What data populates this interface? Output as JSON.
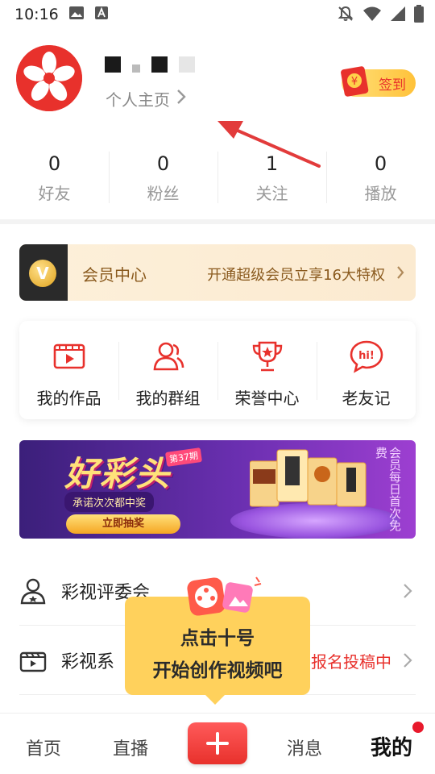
{
  "status_bar": {
    "time": "10:16",
    "icons": [
      "image-icon",
      "a-icon",
      "mute-icon",
      "wifi-icon",
      "signal-icon",
      "battery-icon"
    ]
  },
  "profile": {
    "homepage_label": "个人主页",
    "checkin_label": "签到",
    "checkin_envelope_glyph": "¥"
  },
  "stats": [
    {
      "value": "0",
      "label": "好友"
    },
    {
      "value": "0",
      "label": "粉丝"
    },
    {
      "value": "1",
      "label": "关注"
    },
    {
      "value": "0",
      "label": "播放"
    }
  ],
  "vip": {
    "badge": "V",
    "title": "会员中心",
    "description": "开通超级会员立享16大特权"
  },
  "shortcuts": [
    {
      "label": "我的作品",
      "icon": "video-icon"
    },
    {
      "label": "我的群组",
      "icon": "group-icon"
    },
    {
      "label": "荣誉中心",
      "icon": "trophy-icon"
    },
    {
      "label": "老友记",
      "icon": "chat-bubble-icon"
    }
  ],
  "banner": {
    "title": "好彩头",
    "tag": "第37期",
    "subtitle": "承诺次次都中奖",
    "button": "立即抽奖",
    "side_text": "会员每日首次免费"
  },
  "menu": [
    {
      "label": "彩视评委会",
      "icon": "jury-icon",
      "right_text": ""
    },
    {
      "label": "彩视系",
      "icon": "clapperboard-icon",
      "right_text": "报名投稿中"
    }
  ],
  "popup": {
    "line1": "点击十号",
    "line2": "开始创作视频吧"
  },
  "bottom_nav": [
    {
      "label": "首页"
    },
    {
      "label": "直播"
    },
    {
      "label": "消息"
    },
    {
      "label": "我的"
    }
  ],
  "colors": {
    "brand_red": "#e8312c",
    "popup_yellow": "#ffd15c",
    "vip_brown": "#8a5a1e"
  }
}
